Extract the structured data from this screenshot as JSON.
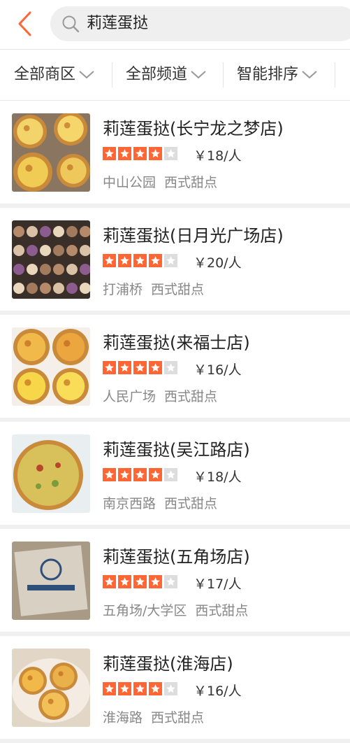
{
  "search": {
    "query": "莉莲蛋挞"
  },
  "filters": [
    "全部商区",
    "全部频道",
    "智能排序"
  ],
  "colors": {
    "accent": "#ff6633",
    "star_off": "#dddddd"
  },
  "shops": [
    {
      "name": "莉莲蛋挞(长宁龙之梦店)",
      "rating": 4,
      "price": "￥18/人",
      "area": "中山公园",
      "category": "西式甜点",
      "photo": "egg-tarts"
    },
    {
      "name": "莉莲蛋挞(日月光广场店)",
      "rating": 4,
      "price": "￥20/人",
      "area": "打浦桥",
      "category": "西式甜点",
      "photo": "display-case"
    },
    {
      "name": "莉莲蛋挞(来福士店)",
      "rating": 4,
      "price": "￥16/人",
      "area": "人民广场",
      "category": "西式甜点",
      "photo": "egg-tarts-box"
    },
    {
      "name": "莉莲蛋挞(吴江路店)",
      "rating": 4,
      "price": "￥18/人",
      "area": "南京西路",
      "category": "西式甜点",
      "photo": "quiche"
    },
    {
      "name": "莉莲蛋挞(五角场店)",
      "rating": 4,
      "price": "￥17/人",
      "area": "五角场/大学区",
      "category": "西式甜点",
      "photo": "paper-bag"
    },
    {
      "name": "莉莲蛋挞(淮海店)",
      "rating": 4,
      "price": "￥16/人",
      "area": "淮海路",
      "category": "西式甜点",
      "photo": "egg-tarts-plate"
    }
  ]
}
